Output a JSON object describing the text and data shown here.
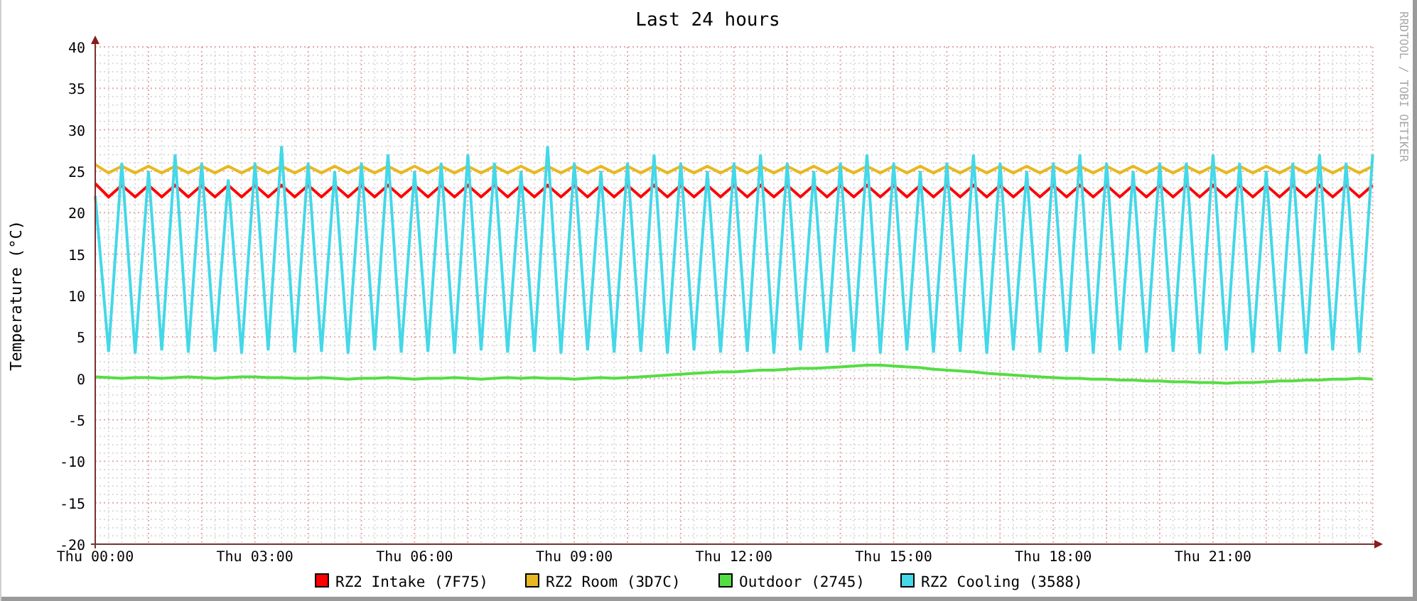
{
  "chart": {
    "side_text": "RRDTOOL / TOBI OETIKER",
    "chart_data": {
      "type": "line",
      "title": "Last 24 hours",
      "ylabel": "Temperature (°C)",
      "ylim": [
        -20,
        40
      ],
      "grid": true,
      "legend": "bottom",
      "yticks": [
        -20,
        -15,
        -10,
        -5,
        0,
        5,
        10,
        15,
        20,
        25,
        30,
        35,
        40
      ],
      "categories": [
        "Thu 00:00",
        null,
        null,
        null,
        null,
        null,
        null,
        null,
        null,
        null,
        null,
        null,
        "Thu 03:00",
        null,
        null,
        null,
        null,
        null,
        null,
        null,
        null,
        null,
        null,
        null,
        "Thu 06:00",
        null,
        null,
        null,
        null,
        null,
        null,
        null,
        null,
        null,
        null,
        null,
        "Thu 09:00",
        null,
        null,
        null,
        null,
        null,
        null,
        null,
        null,
        null,
        null,
        null,
        "Thu 12:00",
        null,
        null,
        null,
        null,
        null,
        null,
        null,
        null,
        null,
        null,
        null,
        "Thu 15:00",
        null,
        null,
        null,
        null,
        null,
        null,
        null,
        null,
        null,
        null,
        null,
        "Thu 18:00",
        null,
        null,
        null,
        null,
        null,
        null,
        null,
        null,
        null,
        null,
        null,
        "Thu 21:00",
        null,
        null,
        null,
        null,
        null,
        null,
        null,
        null,
        null,
        null,
        null,
        null
      ],
      "series": [
        {
          "name": "RZ2 Intake (7F75)",
          "color": "#ff0000",
          "values": [
            23.5,
            21.9,
            23.3,
            21.9,
            23.3,
            21.9,
            23.3,
            21.9,
            23.3,
            21.9,
            23.3,
            21.9,
            23.3,
            21.9,
            23.3,
            21.9,
            23.3,
            21.9,
            23.3,
            21.9,
            23.3,
            21.9,
            23.3,
            21.9,
            23.3,
            21.9,
            23.3,
            21.9,
            23.3,
            21.9,
            23.3,
            21.9,
            23.3,
            21.9,
            23.3,
            21.9,
            23.3,
            21.9,
            23.3,
            21.9,
            23.3,
            21.9,
            23.3,
            21.9,
            23.3,
            21.9,
            23.3,
            21.9,
            23.3,
            21.9,
            23.3,
            21.9,
            23.3,
            21.9,
            23.3,
            21.9,
            23.3,
            21.9,
            23.3,
            21.9,
            23.3,
            21.9,
            23.3,
            21.9,
            23.3,
            21.9,
            23.3,
            21.9,
            23.3,
            21.9,
            23.3,
            21.9,
            23.3,
            21.9,
            23.3,
            21.9,
            23.3,
            21.9,
            23.3,
            21.9,
            23.3,
            21.9,
            23.3,
            21.9,
            23.3,
            21.9,
            23.3,
            21.9,
            23.3,
            21.9,
            23.3,
            21.9,
            23.3,
            21.9,
            23.3,
            21.9,
            23.3
          ]
        },
        {
          "name": "RZ2 Room (3D7C)",
          "color": "#e8b820",
          "values": [
            25.8,
            24.8,
            25.6,
            24.8,
            25.6,
            24.8,
            25.6,
            24.8,
            25.6,
            24.8,
            25.6,
            24.8,
            25.6,
            24.8,
            25.6,
            24.8,
            25.6,
            24.8,
            25.6,
            24.8,
            25.6,
            24.8,
            25.6,
            24.8,
            25.6,
            24.8,
            25.6,
            24.8,
            25.6,
            24.8,
            25.6,
            24.8,
            25.6,
            24.8,
            25.6,
            24.8,
            25.6,
            24.8,
            25.6,
            24.8,
            25.6,
            24.8,
            25.6,
            24.8,
            25.6,
            24.8,
            25.6,
            24.8,
            25.6,
            24.8,
            25.6,
            24.8,
            25.6,
            24.8,
            25.6,
            24.8,
            25.6,
            24.8,
            25.6,
            24.8,
            25.6,
            24.8,
            25.6,
            24.8,
            25.6,
            24.8,
            25.6,
            24.8,
            25.6,
            24.8,
            25.6,
            24.8,
            25.6,
            24.8,
            25.6,
            24.8,
            25.6,
            24.8,
            25.6,
            24.8,
            25.6,
            24.8,
            25.6,
            24.8,
            25.6,
            24.8,
            25.6,
            24.8,
            25.6,
            24.8,
            25.6,
            24.8,
            25.6,
            24.8,
            25.6,
            24.8,
            25.6
          ]
        },
        {
          "name": "Outdoor (2745)",
          "color": "#55dd44",
          "values": [
            0.2,
            0.1,
            0,
            0.1,
            0.1,
            0,
            0.1,
            0.2,
            0.1,
            0,
            0.1,
            0.2,
            0.2,
            0.1,
            0.1,
            0,
            0,
            0.1,
            0,
            -0.1,
            0,
            0,
            0.1,
            0,
            -0.1,
            0,
            0,
            0.1,
            0,
            -0.1,
            0,
            0.1,
            0,
            0.1,
            0,
            0,
            -0.1,
            0,
            0.1,
            0,
            0.1,
            0.2,
            0.3,
            0.4,
            0.5,
            0.6,
            0.7,
            0.8,
            0.8,
            0.9,
            1,
            1,
            1.1,
            1.2,
            1.2,
            1.3,
            1.4,
            1.5,
            1.6,
            1.6,
            1.5,
            1.4,
            1.3,
            1.1,
            1,
            0.9,
            0.8,
            0.6,
            0.5,
            0.4,
            0.3,
            0.2,
            0.1,
            0,
            0,
            -0.1,
            -0.1,
            -0.2,
            -0.2,
            -0.3,
            -0.3,
            -0.4,
            -0.4,
            -0.5,
            -0.5,
            -0.6,
            -0.5,
            -0.5,
            -0.4,
            -0.3,
            -0.3,
            -0.2,
            -0.2,
            -0.1,
            -0.1,
            0,
            -0.1
          ]
        },
        {
          "name": "RZ2 Cooling (3588)",
          "color": "#44d8e8",
          "values": [
            22,
            3.2,
            26,
            3,
            25,
            3.4,
            27,
            3.1,
            26,
            3.2,
            24,
            3,
            26,
            3.4,
            28,
            3.1,
            26,
            3.2,
            25,
            3,
            26,
            3.4,
            27,
            3.1,
            25,
            3.2,
            26,
            3,
            27,
            3.4,
            26,
            3.1,
            25,
            3.2,
            28,
            3,
            26,
            3.4,
            25,
            3.1,
            26,
            3.2,
            27,
            3,
            26,
            3.4,
            25,
            3.1,
            26,
            3.2,
            27,
            3,
            26,
            3.4,
            25,
            3.1,
            26,
            3.2,
            27,
            3,
            26,
            3.4,
            25,
            3.1,
            26,
            3.2,
            27,
            3,
            26,
            3.4,
            25,
            3.1,
            26,
            3.2,
            27,
            3,
            26,
            3.4,
            25,
            3.1,
            26,
            3.2,
            26,
            3,
            27,
            3.4,
            26,
            3.1,
            25,
            3.2,
            26,
            3,
            27,
            3.4,
            26,
            3.1,
            27
          ]
        }
      ]
    }
  }
}
